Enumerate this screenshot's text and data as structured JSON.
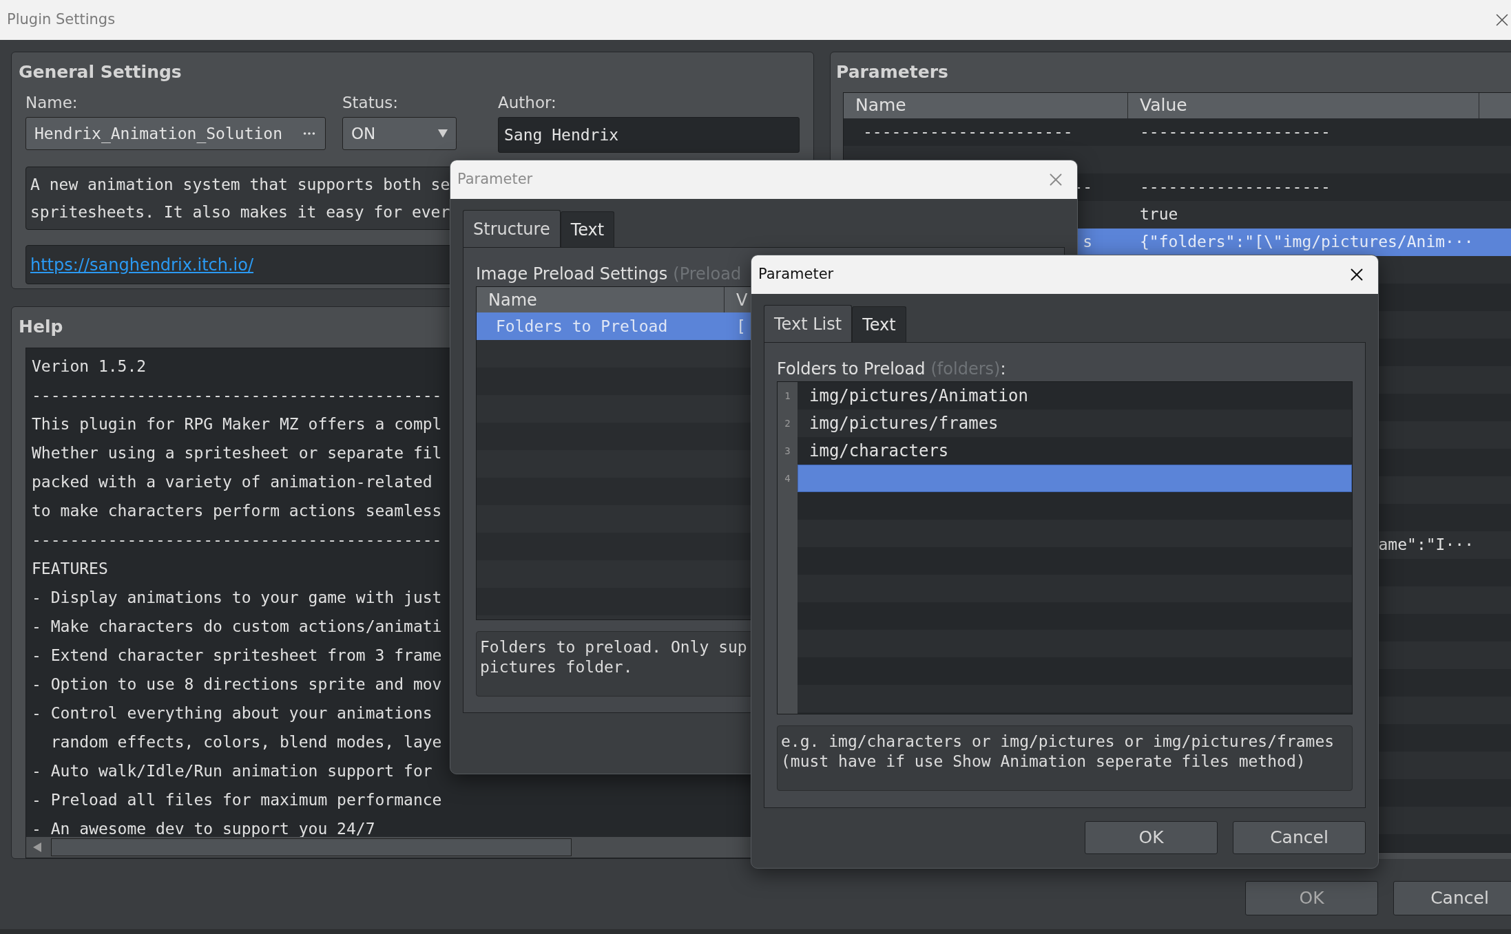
{
  "window": {
    "title": "Plugin Settings"
  },
  "general_settings": {
    "title": "General Settings",
    "name": {
      "label": "Name:",
      "value": "Hendrix_Animation_Solution"
    },
    "status": {
      "label": "Status:",
      "value": "ON"
    },
    "author": {
      "label": "Author:",
      "value": "Sang Hendrix"
    },
    "description": [
      "A new animation system that supports both se",
      "spritesheets. It also makes it easy for ever"
    ],
    "link": "https://sanghendrix.itch.io/"
  },
  "help": {
    "title": "Help",
    "lines": [
      "Verion 1.5.2",
      "-------------------------------------------",
      "This plugin for RPG Maker MZ offers a compl",
      "Whether using a spritesheet or separate fil",
      "packed with a variety of animation-related",
      "to make characters perform actions seamless",
      "-------------------------------------------",
      "FEATURES",
      "- Display animations to your game with just",
      "- Make characters do custom actions/animati",
      "- Extend character spritesheet from 3 frame",
      "- Option to use 8 directions sprite and mov",
      "- Control everything about your animations",
      "  random effects, colors, blend modes, laye",
      "- Auto walk/Idle/Run animation support for",
      "- Preload all files for maximum performance",
      "- An awesome dev to support you 24/7"
    ]
  },
  "parameters": {
    "title": "Parameters",
    "columns": [
      "Name",
      "Value"
    ],
    "rows": [
      {
        "name": "----------------------",
        "value": "--------------------",
        "selected": false
      },
      {
        "selected": false
      },
      {
        "name": "--",
        "name_cut_left": true,
        "value": "--------------------",
        "selected": false
      },
      {
        "value": "true",
        "selected": false
      },
      {
        "name": "s",
        "name_cut_left": true,
        "value": "{\"folders\":\"[\\\"img/pictures/Anim···",
        "selected": true
      },
      {
        "selected": false
      },
      {
        "selected": false
      },
      {
        "selected": false
      },
      {
        "selected": false
      },
      {
        "selected": false
      },
      {
        "selected": false
      },
      {
        "selected": false
      },
      {
        "selected": false
      },
      {
        "selected": false
      },
      {
        "selected": false
      },
      {
        "value": "ame\":\"I···",
        "value_cut_left": true,
        "selected": false
      }
    ]
  },
  "buttons": [
    "OK",
    "Cancel"
  ],
  "dialogs": [
    {
      "kind": "table",
      "title": "Parameter",
      "active": false,
      "tabs": [
        {
          "label": "Structure",
          "selected": true
        },
        {
          "label": "Text",
          "selected": false
        }
      ],
      "label": "Image Preload Settings",
      "key": "(Preload",
      "columns": [
        "Name",
        "V"
      ],
      "rows": [
        {
          "name": "Folders to Preload",
          "value": "[",
          "selected": true
        }
      ],
      "description": [
        "Folders to preload. Only sup",
        "pictures folder."
      ]
    },
    {
      "kind": "list",
      "title": "Parameter",
      "active": true,
      "tabs": [
        {
          "label": "Text List",
          "selected": true
        },
        {
          "label": "Text",
          "selected": false
        }
      ],
      "label": "Folders to Preload",
      "key": "(folders)",
      "suffix": ":",
      "lines": [
        {
          "number": "1",
          "text": "img/pictures/Animation",
          "selected": false
        },
        {
          "number": "2",
          "text": "img/pictures/frames",
          "selected": false
        },
        {
          "number": "3",
          "text": "img/characters",
          "selected": false
        },
        {
          "number": "4",
          "selected": true
        }
      ],
      "description": [
        "e.g. img/characters or img/pictures or img/pictures/frames",
        "(must have if use Show Animation seperate files method)"
      ],
      "buttons": [
        "OK",
        "Cancel"
      ]
    }
  ]
}
